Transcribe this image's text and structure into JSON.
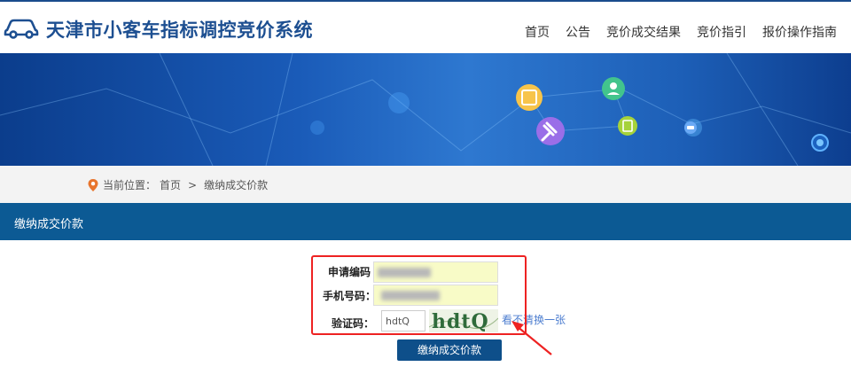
{
  "header": {
    "site_title": "天津市小客车指标调控竞价系统",
    "nav": [
      "首页",
      "公告",
      "竞价成交结果",
      "竞价指引",
      "报价操作指南"
    ]
  },
  "breadcrumb": {
    "prefix": "当前位置：",
    "home": "首页",
    "separator": ">",
    "current": "缴纳成交价款"
  },
  "section": {
    "title": "缴纳成交价款"
  },
  "form": {
    "application_code_label": "申请编码",
    "phone_label": "手机号码：",
    "captcha_label": "验证码：",
    "captcha_value": "hdtQ",
    "captcha_image_text": "hdtQ",
    "refresh_link": "看不清换一张",
    "submit_label": "缴纳成交价款"
  },
  "colors": {
    "brand_blue": "#1d4f91",
    "section_bar": "#0c5a94",
    "button": "#0e4f8a",
    "highlight": "#e22222",
    "input_fill": "#f8fbc7"
  }
}
